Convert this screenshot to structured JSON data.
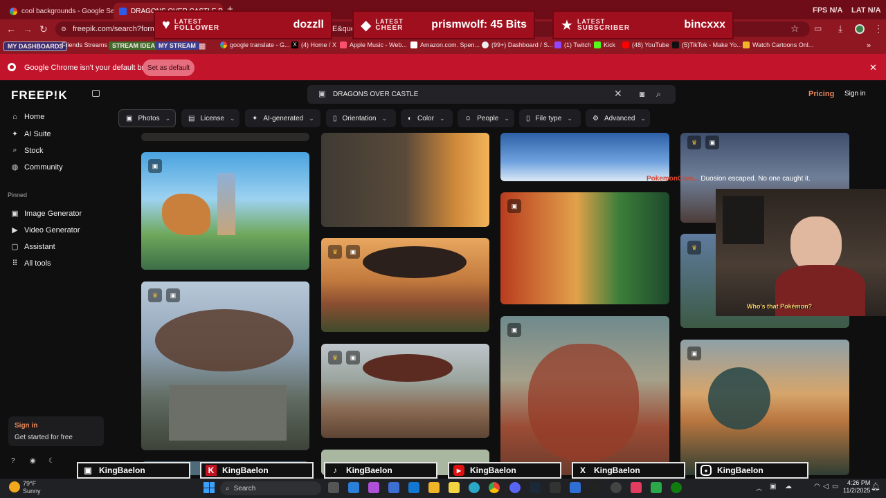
{
  "browser": {
    "tabs": [
      {
        "title": "cool backgrounds - Google Se",
        "active": false
      },
      {
        "title": "DRAGONS OVER CASTLE Photo",
        "active": true
      }
    ],
    "url": "freepik.com/search?format",
    "url_tail": "E&que",
    "perf": {
      "fps_label": "FPS",
      "fps_value": "N/A",
      "lat_label": "LAT",
      "lat_value": "N/A"
    },
    "bookmarks": [
      "MY DASHBOARDS",
      "Friends Streams",
      "STREAM IDEAS",
      "MY STREAM",
      "google translate - G...",
      "(4) Home / X",
      "Apple Music - Web...",
      "Amazon.com. Spen...",
      "(99+) Dashboard / S...",
      "(1) Twitch",
      "Kick",
      "(48) YouTube",
      "(5)TikTok - Make Yo...",
      "Watch Cartoons Onl..."
    ],
    "default_banner": {
      "message": "Google Chrome isn't your default browser",
      "button": "Set as default"
    }
  },
  "alerts": [
    {
      "title_line1": "LATEST",
      "title_line2": "FOLLOWER",
      "value": "dozzll",
      "icon": "heart-icon"
    },
    {
      "title_line1": "LATEST",
      "title_line2": "CHEER",
      "value": "prismwolf: 45 Bits",
      "icon": "diamond-icon"
    },
    {
      "title_line1": "LATEST",
      "title_line2": "SUBSCRIBER",
      "value": "bincxxx",
      "icon": "star-icon"
    }
  ],
  "freepik": {
    "logo": "FREEP!K",
    "search_value": "DRAGONS OVER CASTLE",
    "pricing": "Pricing",
    "signin": "Sign in",
    "nav": [
      "Home",
      "AI Suite",
      "Stock",
      "Community"
    ],
    "pinned_label": "Pinned",
    "pinned": [
      "Image Generator",
      "Video Generator",
      "Assistant",
      "All tools"
    ],
    "signbox": {
      "title": "Sign in",
      "subtitle": "Get started for free"
    },
    "filters": [
      "Photos",
      "License",
      "AI-generated",
      "Orientation",
      "Color",
      "People",
      "File type",
      "Advanced"
    ]
  },
  "stream": {
    "chat_user": "PokemonCom...",
    "chat_msg": "Duosion escaped. No one caught it.",
    "cam_caption": "Who's that Pokémon?",
    "socials": [
      "KingBaelon",
      "KingBaelon",
      "KingBaelon",
      "KingBaelon",
      "KingBaelon",
      "KingBaelon"
    ]
  },
  "taskbar": {
    "temp": "79°F",
    "weather": "Sunny",
    "search": "Search",
    "time": "4:26 PM",
    "date": "11/2/2025"
  }
}
